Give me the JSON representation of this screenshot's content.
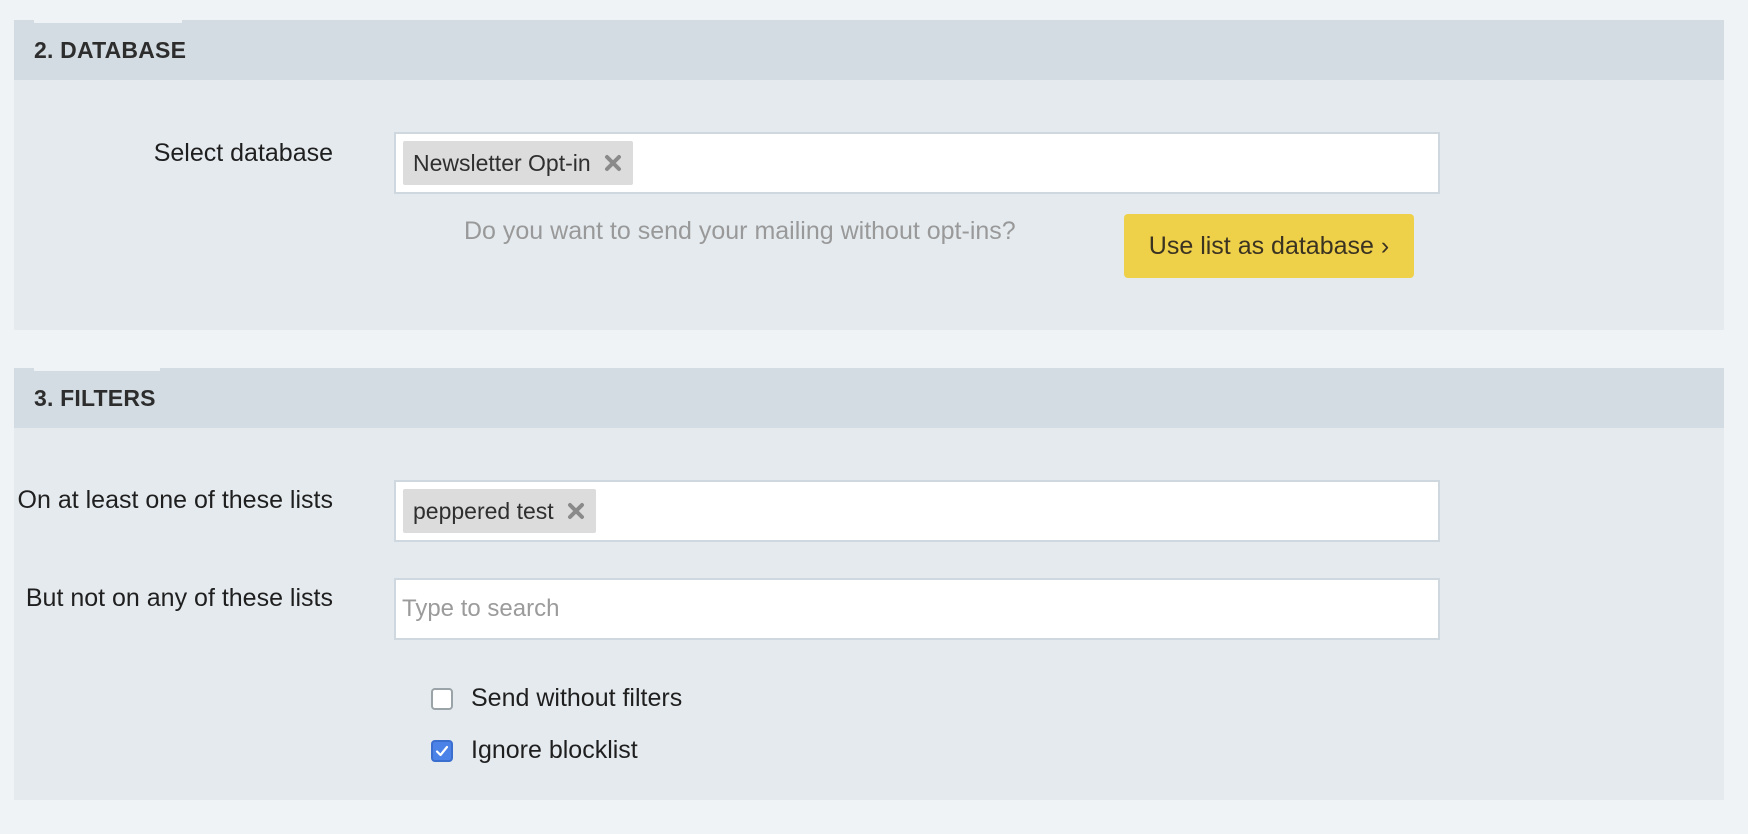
{
  "database_section": {
    "title": "2. DATABASE",
    "select_label": "Select database",
    "selected_tag": "Newsletter Opt-in",
    "hint": "Do you want to send your mailing without opt-ins?",
    "button_label": "Use list as database ›"
  },
  "filters_section": {
    "title": "3. FILTERS",
    "include_label": "On at least one of these lists",
    "include_tag": "peppered test",
    "exclude_label": "But not on any of these lists",
    "exclude_placeholder": "Type to search",
    "checkboxes": [
      {
        "label": "Send without filters",
        "checked": false
      },
      {
        "label": "Ignore blocklist",
        "checked": true
      }
    ]
  },
  "colors": {
    "accent_button": "#efd049",
    "checkbox_checked": "#4b82e7",
    "section_bg": "#e4eaee",
    "header_bg": "#d3dce2"
  },
  "icons": {
    "remove_tag": "close-x-icon",
    "checkmark": "checkmark-icon"
  }
}
